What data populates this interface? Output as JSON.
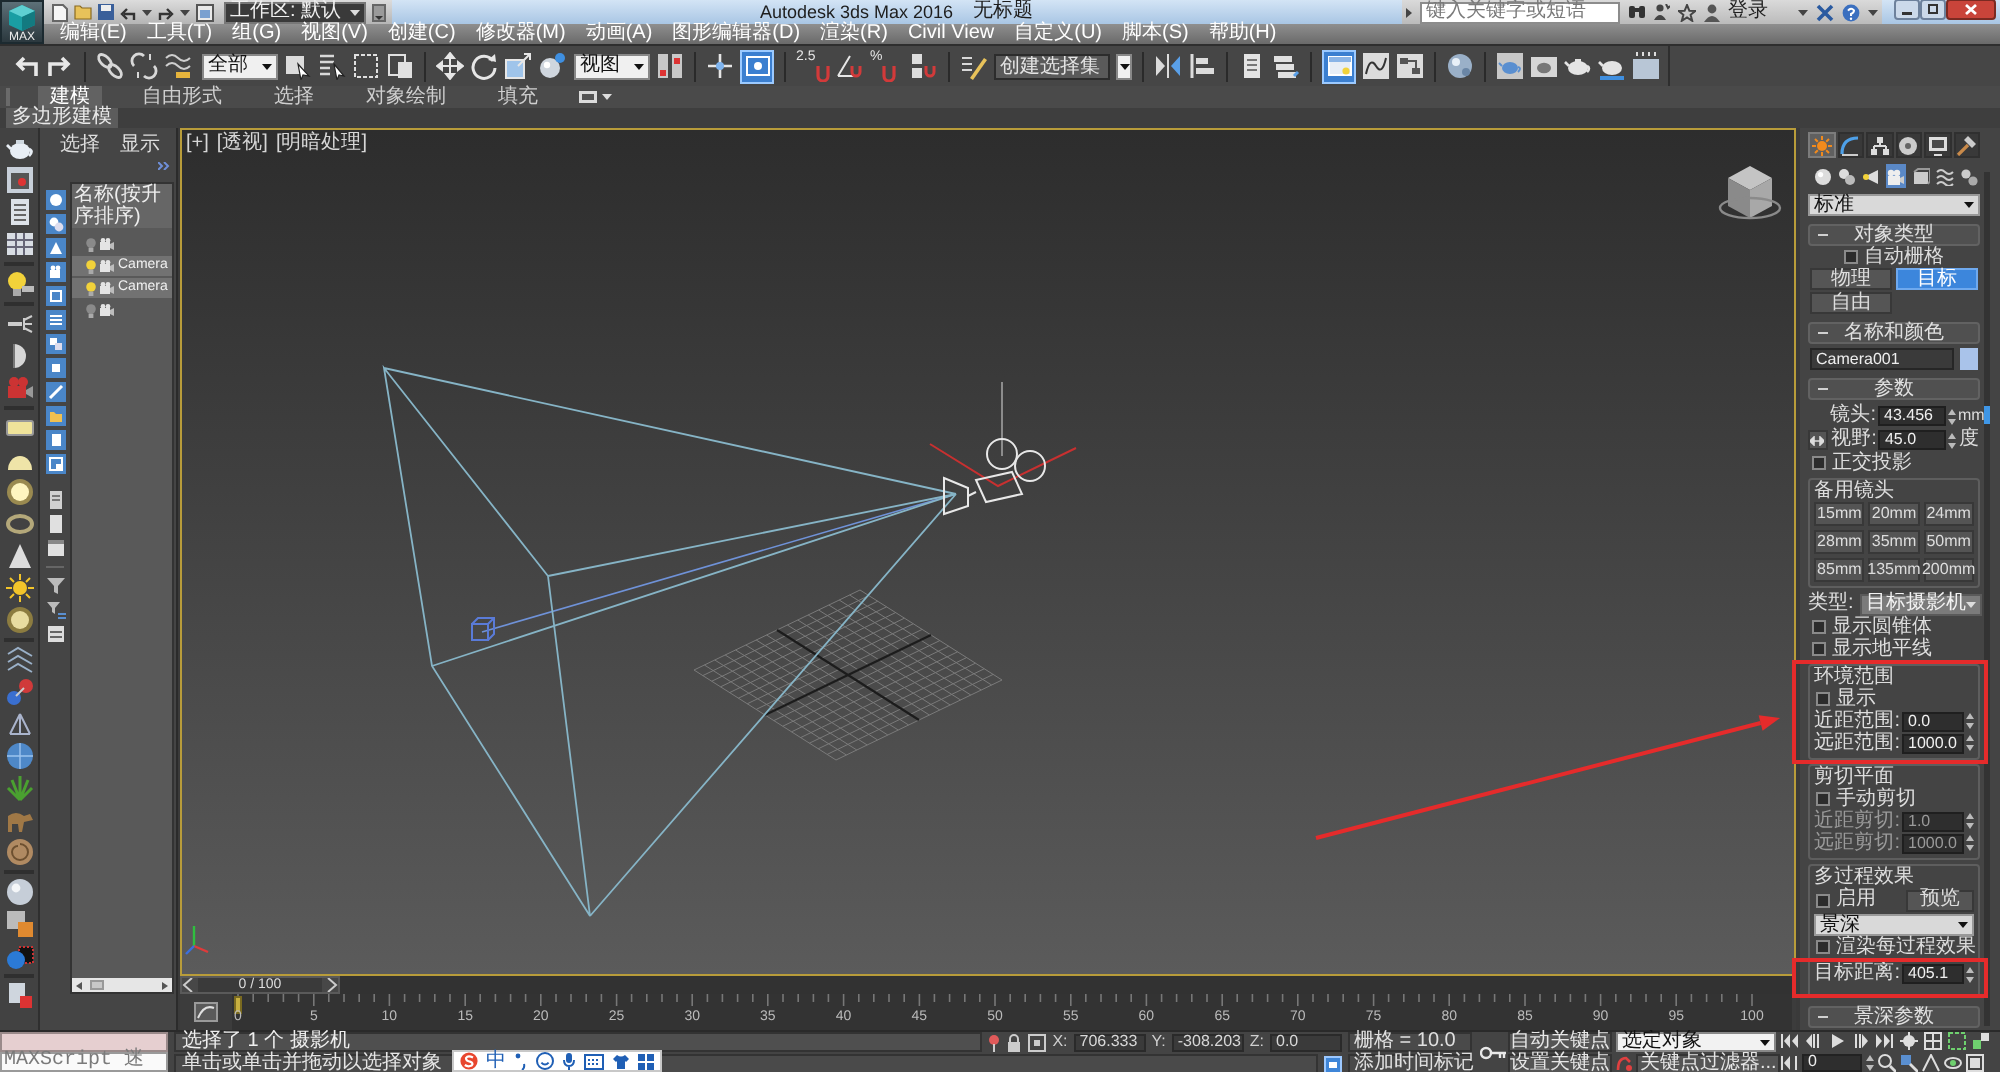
{
  "title_bar": {
    "logo": "MAX",
    "workspace": "工作区: 默认",
    "title": "Autodesk 3ds Max 2016",
    "document": "无标题",
    "search_placeholder": "键入关键字或短语",
    "sign_in": "登录"
  },
  "menu": [
    "编辑(E)",
    "工具(T)",
    "组(G)",
    "视图(V)",
    "创建(C)",
    "修改器(M)",
    "动画(A)",
    "图形编辑器(D)",
    "渲染(R)",
    "Civil View",
    "自定义(U)",
    "脚本(S)",
    "帮助(H)"
  ],
  "toolbar": {
    "selection_filter": "全部",
    "reference_coordinates": "视图",
    "snap_labels": [
      "2.5",
      "%"
    ],
    "toggles": [
      {
        "on": true
      },
      {
        "on": true
      }
    ],
    "selection_set_placeholder": "创建选择集"
  },
  "ribbon": {
    "tabs": [
      {
        "label": "建模",
        "selected": true
      },
      {
        "label": "自由形式",
        "selected": false
      },
      {
        "label": "选择",
        "selected": false
      },
      {
        "label": "对象绘制",
        "selected": false
      },
      {
        "label": "填充",
        "selected": false
      }
    ],
    "panel": "多边形建模"
  },
  "scene_explorer": {
    "tabs": [
      "选择",
      "显示"
    ],
    "column": "名称(按升序排序)",
    "rows": [
      {
        "light_on": false,
        "selected": false
      },
      {
        "name": "Camera",
        "light_on": true,
        "selected": true
      },
      {
        "name": "Camera",
        "light_on": true,
        "selected": true
      },
      {
        "light_on": false,
        "selected": false
      }
    ]
  },
  "viewport": {
    "labels": [
      "[+]",
      "[透视]",
      "[明暗处理]"
    ]
  },
  "time_slider": {
    "position": "0 / 100"
  },
  "track_bar": {
    "ticks": [
      "0",
      "5",
      "10",
      "15",
      "20",
      "25",
      "30",
      "35",
      "40",
      "45",
      "50",
      "55",
      "60",
      "65",
      "70",
      "75",
      "80",
      "85",
      "90",
      "95",
      "100"
    ]
  },
  "command_panel": {
    "tabs": [
      {
        "selected": true
      },
      {
        "selected": false
      },
      {
        "selected": false
      },
      {
        "selected": false
      },
      {
        "selected": false
      },
      {
        "selected": false
      }
    ],
    "categories": [
      {
        "selected": false
      },
      {
        "selected": false
      },
      {
        "selected": false
      },
      {
        "selected": true
      },
      {
        "selected": false
      },
      {
        "selected": false
      },
      {
        "selected": false
      }
    ],
    "subcategory": "标准",
    "object_type": {
      "title": "对象类型",
      "expanded": true,
      "autogrid": {
        "label": "自动栅格",
        "checked": false
      },
      "buttons": [
        {
          "label": "物理",
          "selected": false
        },
        {
          "label": "目标",
          "selected": true
        },
        {
          "label": "自由",
          "selected": false
        }
      ]
    },
    "name_and_color": {
      "title": "名称和颜色",
      "expanded": true,
      "name": "Camera001",
      "color": "#a9c3ea"
    },
    "parameters": {
      "title": "参数",
      "expanded": true,
      "lens": {
        "label": "镜头:",
        "value": "43.456",
        "unit": "mm"
      },
      "fov": {
        "label": "视野:",
        "value": "45.0",
        "unit": "度"
      },
      "orthographic": {
        "label": "正交投影",
        "checked": false
      },
      "stock_lenses": {
        "title": "备用镜头",
        "buttons": [
          "15mm",
          "20mm",
          "24mm",
          "28mm",
          "35mm",
          "50mm",
          "85mm",
          "135mm",
          "200mm"
        ]
      },
      "type": {
        "label": "类型:",
        "value": "目标摄影机"
      },
      "show_cone": {
        "label": "显示圆锥体",
        "checked": false
      },
      "show_horizon": {
        "label": "显示地平线",
        "checked": false
      },
      "environment_ranges": {
        "title": "环境范围",
        "show": {
          "label": "显示",
          "checked": false
        },
        "near": {
          "label": "近距范围:",
          "value": "0.0",
          "disabled": false
        },
        "far": {
          "label": "远距范围:",
          "value": "1000.0",
          "disabled": false
        }
      },
      "clipping_planes": {
        "title": "剪切平面",
        "manual": {
          "label": "手动剪切",
          "checked": false
        },
        "near": {
          "label": "近距剪切:",
          "value": "1.0",
          "disabled": true
        },
        "far": {
          "label": "远距剪切:",
          "value": "1000.0",
          "disabled": true
        }
      },
      "multi_pass": {
        "title": "多过程效果",
        "enable": {
          "label": "启用",
          "checked": false
        },
        "preview": "预览",
        "effect": "景深",
        "per_pass": {
          "label": "渲染每过程效果",
          "checked": false
        },
        "target_distance": {
          "label": "目标距离:",
          "value": "405.1",
          "disabled": false
        }
      }
    },
    "more_rollouts": [
      {
        "title": "景深参数",
        "expanded": true
      }
    ]
  },
  "status_bar": {
    "listener": "MAXScript 迷",
    "selection": "选择了 1 个 摄影机",
    "prompt": "单击或单击并拖动以选择对象",
    "coordinates": [
      {
        "axis": "X:",
        "value": "706.333"
      },
      {
        "axis": "Y:",
        "value": "-308.203"
      },
      {
        "axis": "Z:",
        "value": "0.0"
      }
    ],
    "grid": "栅格 = 10.0",
    "time_tag": "添加时间标记",
    "auto_key": "自动关键点",
    "key_mode": "选定对象",
    "set_key": "设置关键点",
    "key_filters": "关键点过滤器...",
    "frame": "0"
  },
  "ime_toolbar": {
    "mode": "中"
  }
}
